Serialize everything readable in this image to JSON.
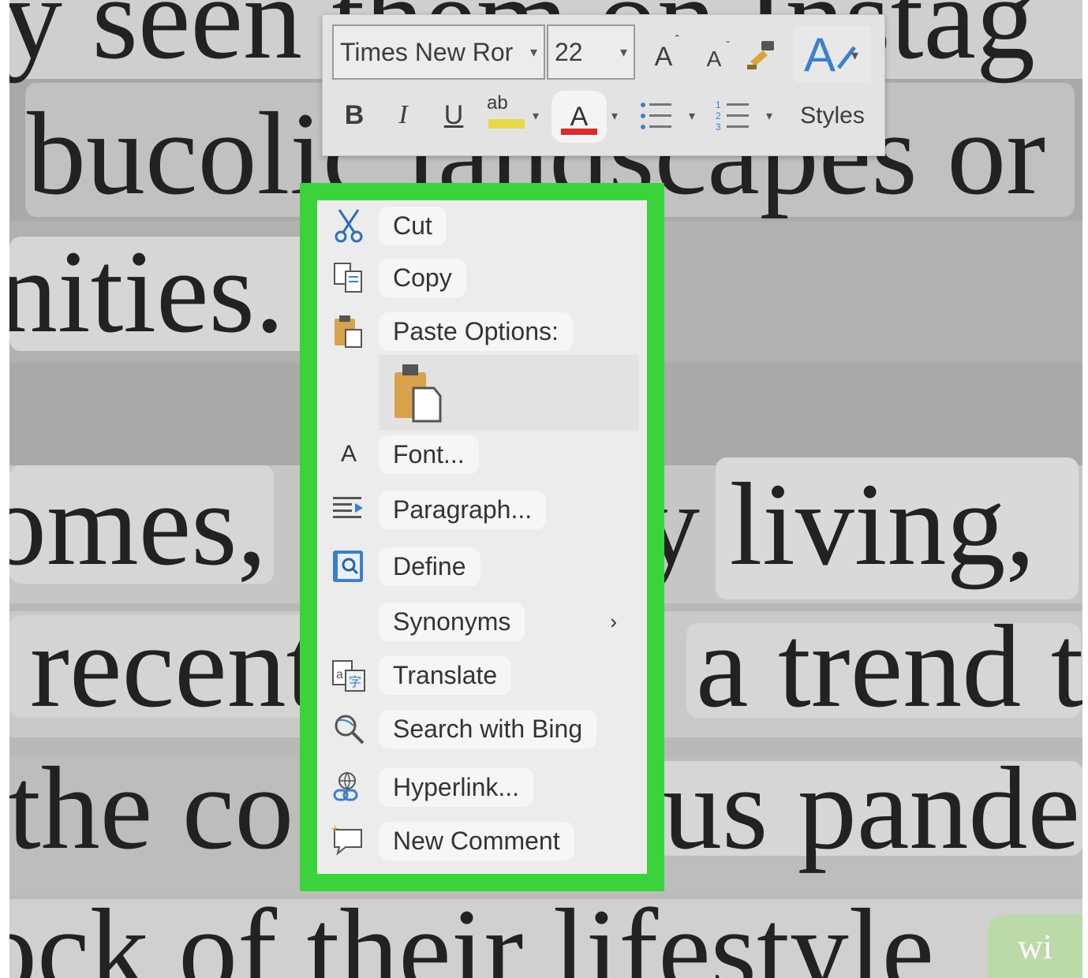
{
  "document": {
    "lines": [
      "y seen them on Instag",
      "bucolic landscapes or",
      "nities.",
      "omes,",
      "y living,",
      "recent",
      "a trend t",
      "the co",
      "us pande",
      "ock of their lifestyle"
    ],
    "corner_text": "wi"
  },
  "mini_toolbar": {
    "font_name": "Times New Ror",
    "font_size": "22",
    "grow_font": "A",
    "shrink_font": "A",
    "bold": "B",
    "italic": "I",
    "underline": "U",
    "highlight": "ab",
    "font_color": "A",
    "styles_label": "Styles",
    "icons": [
      "dropdown-caret",
      "grow-font-icon",
      "shrink-font-icon",
      "format-painter-icon",
      "text-effects-icon",
      "highlight-icon",
      "font-color-icon",
      "bullets-icon",
      "numbering-icon"
    ],
    "font_color_hex": "#d92b2b",
    "highlight_hex": "#e8d84a"
  },
  "context_menu": {
    "accent_hex": "#3bd33b",
    "items": [
      {
        "label": "Cut",
        "icon": "scissors-icon"
      },
      {
        "label": "Copy",
        "icon": "copy-icon"
      },
      {
        "label": "Paste Options:",
        "icon": "paste-icon"
      },
      {
        "label": "Font...",
        "icon": "font-icon"
      },
      {
        "label": "Paragraph...",
        "icon": "paragraph-icon"
      },
      {
        "label": "Define",
        "icon": "define-icon"
      },
      {
        "label": "Synonyms",
        "icon": "synonyms-arrow-icon",
        "submenu": "›"
      },
      {
        "label": "Translate",
        "icon": "translate-icon"
      },
      {
        "label": "Search with Bing",
        "icon": "search-bing-icon"
      },
      {
        "label": "Hyperlink...",
        "icon": "hyperlink-icon"
      },
      {
        "label": "New Comment",
        "icon": "new-comment-icon"
      }
    ]
  }
}
